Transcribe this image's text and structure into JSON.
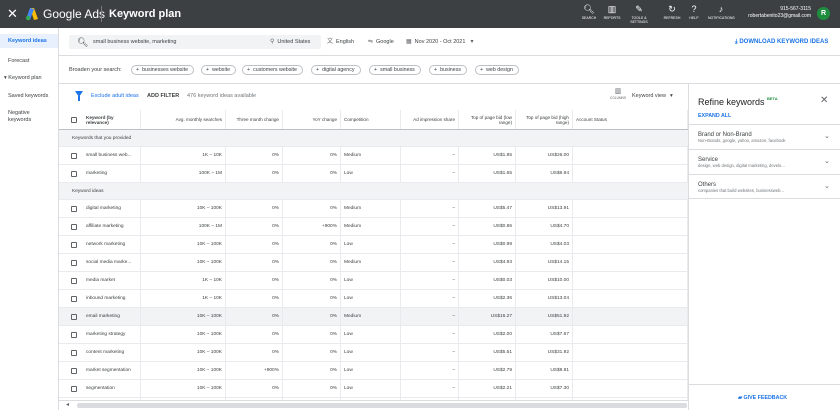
{
  "topbar": {
    "brand": "Google Ads",
    "page_title": "Keyword plan",
    "icons": [
      {
        "label": "SEARCH",
        "icon": "search-icon"
      },
      {
        "label": "REPORTS",
        "icon": "reports-icon"
      },
      {
        "label": "TOOLS & SETTINGS",
        "icon": "wrench-icon"
      },
      {
        "label": "REFRESH",
        "icon": "refresh-icon"
      },
      {
        "label": "HELP",
        "icon": "help-icon"
      },
      {
        "label": "NOTIFICATIONS",
        "icon": "bell-icon"
      }
    ],
    "account_phone": "915-567-3115",
    "account_email": "robertabenito23@gmail.com",
    "avatar_letter": "R"
  },
  "leftnav": {
    "items": [
      {
        "label": "Keyword ideas",
        "active": true
      },
      {
        "label": "Forecast"
      },
      {
        "label": "▾ Keyword plan"
      },
      {
        "label": "Saved keywords"
      },
      {
        "label": "Negative keywords"
      }
    ]
  },
  "search": {
    "query": "small business website, marketing",
    "location": "United States",
    "language": "English",
    "network": "Google",
    "date_range": "Nov 2020 - Oct 2021",
    "download_label": "DOWNLOAD KEYWORD IDEAS"
  },
  "broaden": {
    "label": "Broaden your search:",
    "chips": [
      "businesses website",
      "website",
      "customers website",
      "digital agency",
      "small business",
      "business",
      "web design"
    ]
  },
  "toolbar": {
    "exclude_adult": "Exclude adult ideas",
    "add_filter": "ADD FILTER",
    "count": "476 keyword ideas available",
    "columns_label": "COLUMNS",
    "view": "Keyword view"
  },
  "table": {
    "headers": [
      "Keyword (by relevance)",
      "Avg. monthly searches",
      "Three month change",
      "YoY change",
      "Competition",
      "Ad impression share",
      "Top of page bid (low range)",
      "Top of page bid (high range)",
      "Account Status"
    ],
    "groups": [
      {
        "title": "Keywords that you provided",
        "rows": [
          [
            "small business web...",
            "1K – 10K",
            "0%",
            "0%",
            "Medium",
            "–",
            "US$1.85",
            "US$26.00",
            ""
          ],
          [
            "marketing",
            "100K – 1M",
            "0%",
            "0%",
            "Low",
            "–",
            "US$1.65",
            "US$6.94",
            ""
          ]
        ]
      },
      {
        "title": "Keyword ideas",
        "rows": [
          [
            "digital marketing",
            "10K – 100K",
            "0%",
            "0%",
            "Medium",
            "–",
            "US$5.47",
            "US$13.91",
            ""
          ],
          [
            "affiliate marketing",
            "100K – 1M",
            "0%",
            "+900%",
            "Medium",
            "–",
            "US$0.86",
            "US$4.70",
            ""
          ],
          [
            "network marketing",
            "10K – 100K",
            "0%",
            "0%",
            "Low",
            "–",
            "US$0.99",
            "US$4.03",
            ""
          ],
          [
            "social media marke...",
            "10K – 100K",
            "0%",
            "0%",
            "Medium",
            "–",
            "US$4.93",
            "US$14.15",
            ""
          ],
          [
            "media market",
            "1K – 10K",
            "0%",
            "0%",
            "Low",
            "–",
            "US$0.03",
            "US$10.00",
            ""
          ],
          [
            "inbound marketing",
            "1K – 10K",
            "0%",
            "0%",
            "Low",
            "–",
            "US$2.36",
            "US$13.04",
            ""
          ],
          [
            "email marketing",
            "10K – 100K",
            "0%",
            "0%",
            "Medium",
            "–",
            "US$16.27",
            "US$51.92",
            ""
          ],
          [
            "marketing strategy",
            "10K – 100K",
            "0%",
            "0%",
            "Low",
            "–",
            "US$2.00",
            "US$7.67",
            ""
          ],
          [
            "content marketing",
            "10K – 100K",
            "0%",
            "0%",
            "Low",
            "–",
            "US$5.51",
            "US$31.92",
            ""
          ],
          [
            "market segmentation",
            "10K – 100K",
            "+900%",
            "0%",
            "Low",
            "–",
            "US$2.79",
            "US$8.81",
            ""
          ],
          [
            "segmentation",
            "10K – 100K",
            "0%",
            "0%",
            "Low",
            "–",
            "US$2.21",
            "US$7.30",
            ""
          ],
          [
            "marketing manage...",
            "10K – 100K",
            "0%",
            "0%",
            "Low",
            "–",
            "US$1.64",
            "US$10.54",
            ""
          ]
        ]
      }
    ]
  },
  "refine": {
    "title": "Refine keywords",
    "beta": "BETA",
    "expand_all": "EXPAND ALL",
    "sections": [
      {
        "title": "Brand or Non-Brand",
        "subtitle": "Non-Brands, google, yahoo, amazon, facebook"
      },
      {
        "title": "Service",
        "subtitle": "design, web design, digital marketing, develo..."
      },
      {
        "title": "Others",
        "subtitle": "companies that build websites, businessweb..."
      }
    ],
    "feedback": "GIVE FEEDBACK"
  },
  "colors": {
    "topbar": "#3c4043",
    "accent": "#1a73e8",
    "avatar": "#1e8e3e"
  }
}
